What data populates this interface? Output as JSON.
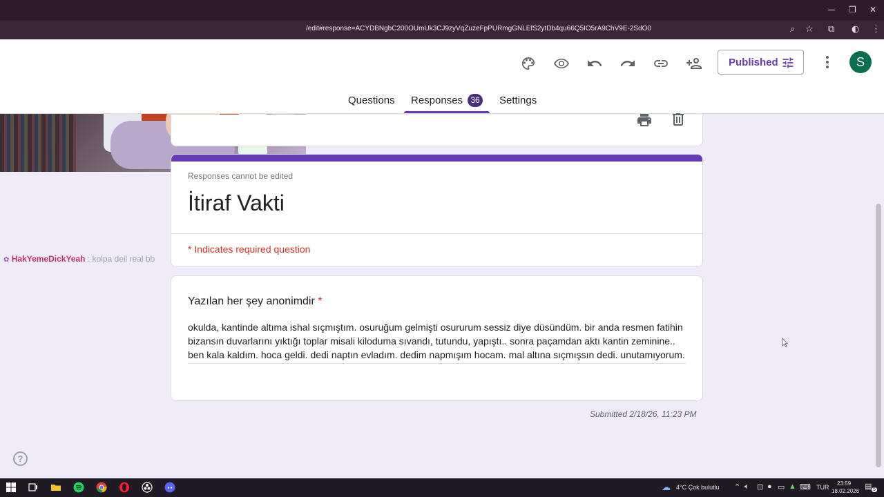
{
  "browser": {
    "url": "/edit#response=ACYDBNgbC200OUmUk3CJ9zyVqZuzeFpPURmgGNLEfS2ytDb4qu66Q5IO5rA9ChV9E-2SdO0",
    "window_controls": {
      "minimize": "—",
      "restore": "❐",
      "close": "✕"
    }
  },
  "header": {
    "published_label": "Published",
    "avatar_letter": "S",
    "tabs": [
      {
        "label": "Questions"
      },
      {
        "label": "Responses",
        "badge": "36"
      },
      {
        "label": "Settings"
      }
    ],
    "accent_color": "#673ab7"
  },
  "response": {
    "no_edit_note": "Responses cannot be edited",
    "form_title": "İtiraf Vakti",
    "required_note": "* Indicates required question",
    "question_label": "Yazılan her şey anonimdir",
    "question_required_mark": "*",
    "answer": "okulda, kantinde altıma ishal sıçmıştım. osuruğum gelmişti osururum sessiz diye düsündüm. bir anda resmen fatihin bizansın duvarlarını yıktığı toplar misali kiloduma sıvandı, tutundu, yapıştı.. sonra paçamdan aktı kantin zeminine.. ben kala kaldım. hoca geldi. dedi naptın evladım. dedim napmışım hocam. mal altına sıçmışsın dedi. unutamıyorum.",
    "submitted": "Submitted 2/18/26, 11:23 PM"
  },
  "chat": {
    "user": "HakYemeDickYeah",
    "message": ": kolpa deil real bb"
  },
  "taskbar": {
    "weather": "4°C  Çok bulutlu",
    "language": "TUR",
    "time": "23:59",
    "date": "18.02.2026",
    "notifications": "5"
  },
  "icons": [
    "palette-icon",
    "preview-icon",
    "undo-icon",
    "redo-icon",
    "link-icon",
    "add-collaborator-icon",
    "publish-settings-icon",
    "more-vert-icon",
    "print-icon",
    "delete-icon",
    "help-icon"
  ]
}
